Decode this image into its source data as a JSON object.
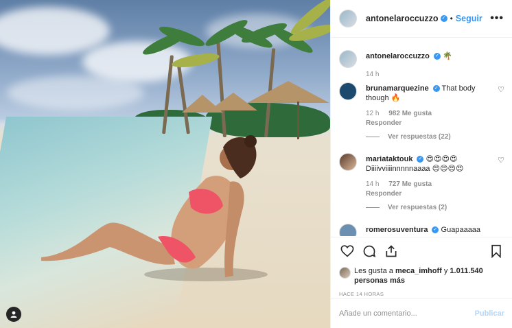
{
  "post": {
    "author": "antonelaroccuzzo",
    "follow_label": "Seguir",
    "separator": "•",
    "more_label": "•••"
  },
  "caption": {
    "user": "antonelaroccuzzo",
    "text": "🌴",
    "time": "14 h"
  },
  "comments": [
    {
      "user": "brunamarquezine",
      "text": "That body though 🔥",
      "time": "12 h",
      "likes": "982 Me gusta",
      "reply_label": "Responder",
      "view_replies": "Ver respuestas (22)"
    },
    {
      "user": "mariataktouk",
      "text": "😍😍😍😍 Diiiivviiiinnnnnaaaa 😍😍😍😍",
      "time": "14 h",
      "likes": "727 Me gusta",
      "reply_label": "Responder",
      "view_replies": "Ver respuestas (2)"
    },
    {
      "user": "romerosuventura",
      "text": "Guapaaaaa"
    }
  ],
  "likes_summary": {
    "prefix": "Les gusta a ",
    "user": "meca_imhoff",
    "connector": " y ",
    "others": "1.011.540 personas más"
  },
  "timestamp": "HACE 14 HORAS",
  "comment_box": {
    "placeholder": "Añade un comentario...",
    "post_label": "Publicar"
  },
  "icons": [
    "heart-icon",
    "comment-icon",
    "share-icon",
    "bookmark-icon",
    "user-tag-icon",
    "verified-icon",
    "more-options-icon"
  ],
  "colors": {
    "accent": "#3897f0",
    "text": "#262626",
    "muted": "#8e8e8e",
    "post_disabled": "#b3d6f8"
  }
}
